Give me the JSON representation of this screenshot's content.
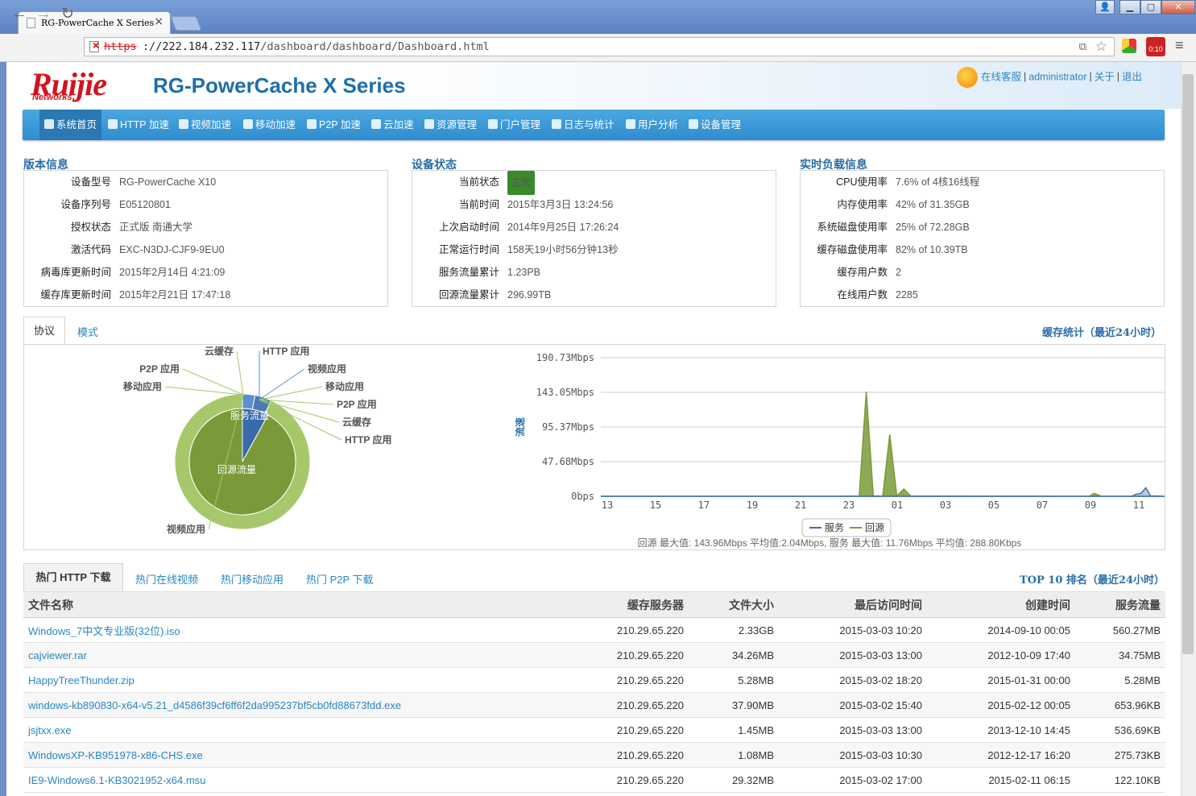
{
  "browser": {
    "tab_title": "RG-PowerCache X Series",
    "url_protocol": "https",
    "url_rest_host": "://222.184.232.117",
    "url_rest_path": "/dashboard/dashboard/Dashboard.html"
  },
  "header": {
    "logo": "Ruijie",
    "logo_sub": "Networks",
    "product_title": "RG-PowerCache X Series",
    "links": {
      "service": "在线客服",
      "user": "administrator",
      "about": "关于",
      "logout": "退出"
    }
  },
  "menu": [
    "系统首页",
    "HTTP 加速",
    "视频加速",
    "移动加速",
    "P2P 加速",
    "云加速",
    "资源管理",
    "门户管理",
    "日志与统计",
    "用户分析",
    "设备管理"
  ],
  "version_info": {
    "title": "版本信息",
    "rows": [
      {
        "k": "设备型号",
        "v": "RG-PowerCache X10"
      },
      {
        "k": "设备序列号",
        "v": "E05120801"
      },
      {
        "k": "授权状态",
        "v": "正式版 南通大学"
      },
      {
        "k": "激活代码",
        "v": "EXC-N3DJ-CJF9-9EU0"
      },
      {
        "k": "病毒库更新时间",
        "v": "2015年2月14日 4:21:09"
      },
      {
        "k": "缓存库更新时间",
        "v": "2015年2月21日 17:47:18"
      }
    ]
  },
  "device_status": {
    "title": "设备状态",
    "rows": [
      {
        "k": "当前状态",
        "v": "正常"
      },
      {
        "k": "当前时间",
        "v": "2015年3月3日 13:24:56"
      },
      {
        "k": "上次启动时间",
        "v": "2014年9月25日 17:26:24"
      },
      {
        "k": "正常运行时间",
        "v": "158天19小时56分钟13秒"
      },
      {
        "k": "服务流量累计",
        "v": "1.23PB"
      },
      {
        "k": "回源流量累计",
        "v": "296.99TB"
      }
    ]
  },
  "load_info": {
    "title": "实时负载信息",
    "rows": [
      {
        "k": "CPU使用率",
        "v": "7.6% of 4核16线程"
      },
      {
        "k": "内存使用率",
        "v": "42% of 31.35GB"
      },
      {
        "k": "系统磁盘使用率",
        "v": "25% of 72.28GB"
      },
      {
        "k": "缓存磁盘使用率",
        "v": "82% of 10.39TB"
      },
      {
        "k": "缓存用户数",
        "v": "2"
      },
      {
        "k": "在线用户数",
        "v": "2285"
      }
    ]
  },
  "stats_tabs": [
    "协议",
    "模式"
  ],
  "stats_title": "缓存统计（最近24小时）",
  "chart_data": [
    {
      "type": "pie",
      "inner_labels": [
        "服务流量",
        "回源流量"
      ],
      "outer_labels_left": [
        "云缓存",
        "P2P 应用",
        "移动应用",
        "视频应用"
      ],
      "outer_labels_right": [
        "HTTP 应用",
        "视频应用",
        "移动应用",
        "P2P 应用",
        "云缓存",
        "HTTP 应用"
      ],
      "inner_slices": [
        {
          "name": "服务流量",
          "value": 8,
          "color": "#3a6aa8"
        },
        {
          "name": "回源流量",
          "value": 92,
          "color": "#7a9a3a"
        }
      ],
      "outer_slices": [
        {
          "name": "HTTP 应用",
          "value": 3,
          "color": "#5b8fcf"
        },
        {
          "name": "视频应用",
          "value": 4,
          "color": "#4a7ab8"
        },
        {
          "name": "回源外环",
          "value": 93,
          "color": "#a6c86a"
        }
      ]
    },
    {
      "type": "area",
      "ylabel": "流速",
      "y_ticks": [
        "190.73Mbps",
        "143.05Mbps",
        "95.37Mbps",
        "47.68Mbps",
        "0bps"
      ],
      "ylim": [
        0,
        190.73
      ],
      "x_ticks": [
        "13",
        "15",
        "17",
        "19",
        "21",
        "23",
        "01",
        "03",
        "05",
        "07",
        "09",
        "11"
      ],
      "legend": [
        "服务",
        "回源"
      ],
      "series_colors": {
        "服务": "#3d6fb0",
        "回源": "#7a9a3a"
      },
      "series": [
        {
          "name": "回源",
          "points": [
            [
              0,
              0
            ],
            [
              10,
              0
            ],
            [
              11.0,
              0.4
            ],
            [
              11.3,
              143.96
            ],
            [
              11.6,
              0.5
            ],
            [
              12.0,
              0.2
            ],
            [
              12.3,
              85
            ],
            [
              12.6,
              0.4
            ],
            [
              12.9,
              10
            ],
            [
              13.2,
              0.3
            ],
            [
              20.8,
              0
            ],
            [
              21.0,
              4
            ],
            [
              21.3,
              0
            ],
            [
              23.6,
              0
            ],
            [
              24,
              0
            ]
          ]
        },
        {
          "name": "服务",
          "points": [
            [
              0,
              0
            ],
            [
              22.6,
              0
            ],
            [
              22.8,
              3
            ],
            [
              23.0,
              4
            ],
            [
              23.2,
              11.76
            ],
            [
              23.4,
              0.5
            ],
            [
              24,
              0
            ]
          ]
        }
      ],
      "footer": "回源 最大值: 143.96Mbps 平均值:2.04Mbps, 服务 最大值: 11.76Mbps 平均值: 288.80Kbps"
    }
  ],
  "hot_tabs": [
    "热门 HTTP 下载",
    "热门在线视频",
    "热门移动应用",
    "热门 P2P 下载"
  ],
  "hot_title": "TOP 10 排名（最近24小时）",
  "table": {
    "headers": [
      "文件名称",
      "缓存服务器",
      "文件大小",
      "最后访问时间",
      "创建时间",
      "服务流量"
    ],
    "rows": [
      [
        "Windows_7中文专业版(32位).iso",
        "210.29.65.220",
        "2.33GB",
        "2015-03-03 10:20",
        "2014-09-10 00:05",
        "560.27MB"
      ],
      [
        "cajviewer.rar",
        "210.29.65.220",
        "34.26MB",
        "2015-03-03 13:00",
        "2012-10-09 17:40",
        "34.75MB"
      ],
      [
        "HappyTreeThunder.zip",
        "210.29.65.220",
        "5.28MB",
        "2015-03-02 18:20",
        "2015-01-31 00:00",
        "5.28MB"
      ],
      [
        "windows-kb890830-x64-v5.21_d4586f39cf6ff6f2da995237bf5cb0fd88673fdd.exe",
        "210.29.65.220",
        "37.90MB",
        "2015-03-02 15:40",
        "2015-02-12 00:05",
        "653.96KB"
      ],
      [
        "jsjtxx.exe",
        "210.29.65.220",
        "1.45MB",
        "2015-03-03 13:00",
        "2013-12-10 14:45",
        "536.69KB"
      ],
      [
        "WindowsXP-KB951978-x86-CHS.exe",
        "210.29.65.220",
        "1.08MB",
        "2015-03-03 10:30",
        "2012-12-17 16:20",
        "275.73KB"
      ],
      [
        "IE9-Windows6.1-KB3021952-x64.msu",
        "210.29.65.220",
        "29.32MB",
        "2015-03-02 17:00",
        "2015-02-11 06:15",
        "122.10KB"
      ]
    ]
  }
}
